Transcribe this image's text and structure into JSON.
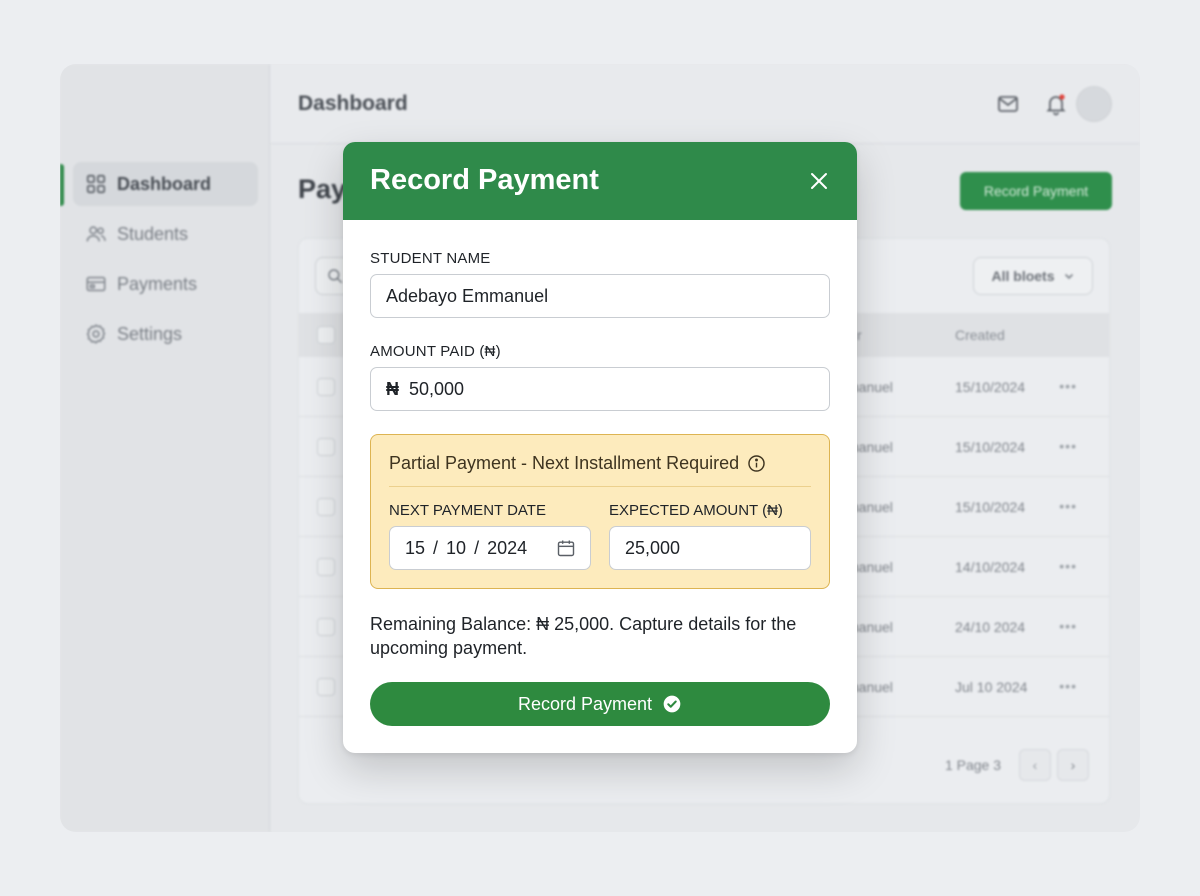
{
  "background": {
    "header_title": "Dashboard",
    "sidebar": {
      "items": [
        {
          "label": "Dashboard",
          "icon": "grid-icon",
          "active": true
        },
        {
          "label": "Students",
          "icon": "users-icon",
          "active": false
        },
        {
          "label": "Payments",
          "icon": "card-icon",
          "active": false
        },
        {
          "label": "Settings",
          "icon": "gear-icon",
          "active": false
        }
      ]
    },
    "page_title": "Pay",
    "primary_button": "Record Payment",
    "filter_label": "All bloets",
    "table": {
      "headers": {
        "payer": "r",
        "created": "Created"
      },
      "rows": [
        {
          "name": "manuel",
          "created": "15/10/2024"
        },
        {
          "name": "manuel",
          "created": "15/10/2024"
        },
        {
          "name": "manuel",
          "created": "15/10/2024"
        },
        {
          "name": "manuel",
          "created": "14/10/2024"
        },
        {
          "name": "manuel",
          "created": "24/10 2024"
        },
        {
          "name": "manuel",
          "created": "Jul 10 2024"
        }
      ],
      "row_menu": "•••"
    },
    "pagination": {
      "text": "1 Page 3",
      "prev": "‹",
      "next": "›"
    },
    "colors": {
      "accent": "#2f8a4a"
    }
  },
  "modal": {
    "title": "Record Payment",
    "close_icon": "close-icon",
    "student_name": {
      "label": "STUDENT NAME",
      "value": "Adebayo Emmanuel"
    },
    "amount_paid": {
      "label": "AMOUNT PAID (₦)",
      "currency": "₦",
      "value": "50,000"
    },
    "partial_notice": {
      "title": "Partial Payment - Next Installment Required",
      "info_icon": "info-icon",
      "next_date": {
        "label": "NEXT PAYMENT DATE",
        "day": "15",
        "month": "10",
        "year": "2024",
        "icon": "calendar-icon"
      },
      "expected_amount": {
        "label": "EXPECTED AMOUNT (₦)",
        "value": "25,000"
      }
    },
    "helper_text": "Remaining Balance: ₦ 25,000. Capture details for the upcoming payment.",
    "submit_label": "Record Payment",
    "submit_icon": "check-circle-icon",
    "colors": {
      "header": "#2f8a4a",
      "button": "#2e8a3f",
      "notice_bg": "#fdebbd",
      "notice_border": "#ddb452"
    }
  }
}
